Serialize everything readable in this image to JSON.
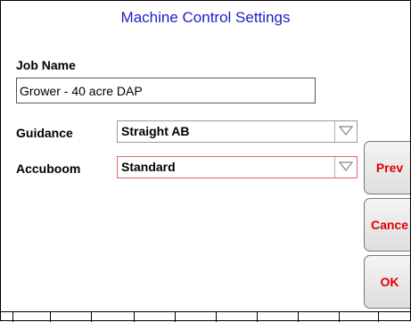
{
  "title": "Machine Control Settings",
  "job_name": {
    "label": "Job Name",
    "value": "Grower - 40 acre DAP"
  },
  "guidance": {
    "label": "Guidance",
    "value": "Straight AB"
  },
  "accuboom": {
    "label": "Accuboom",
    "value": "Standard"
  },
  "buttons": {
    "prev": "Prev",
    "cancel": "Cance",
    "ok": "OK"
  },
  "colors": {
    "title": "#1d1dcc",
    "button_text": "#e00000",
    "accuboom_border": "#e06666"
  },
  "icons": {
    "dropdown": "triangle-down-icon"
  }
}
